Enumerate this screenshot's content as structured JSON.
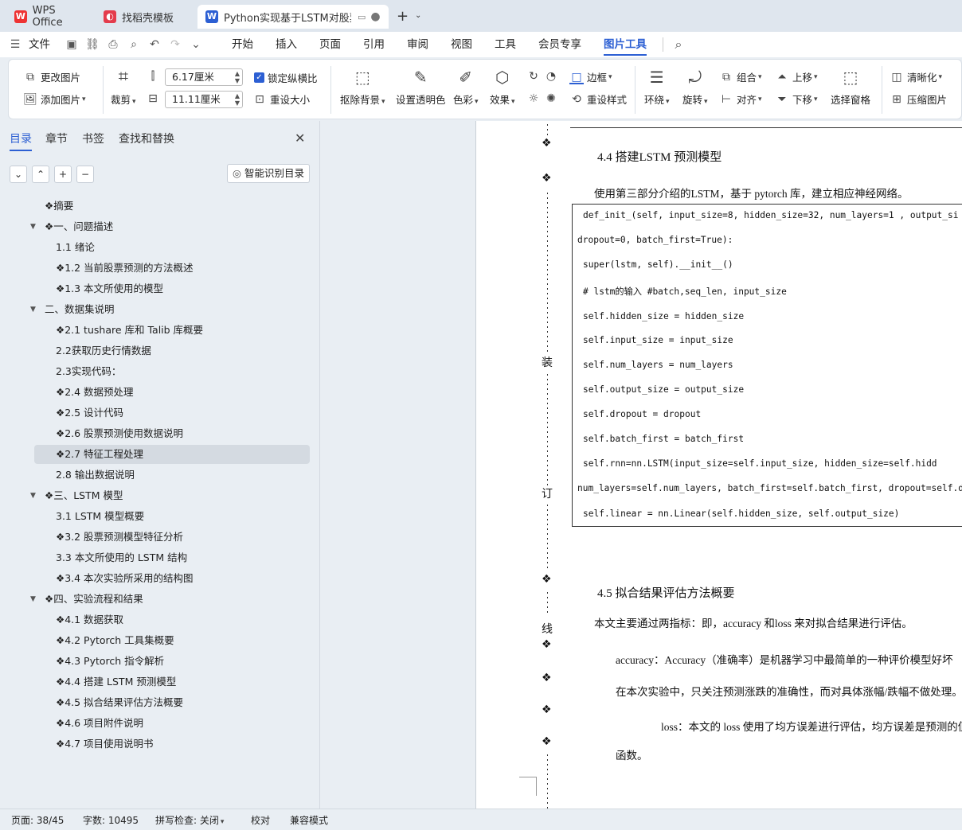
{
  "tabs": [
    {
      "label": "WPS Office",
      "icon": "wps-logo-icon"
    },
    {
      "label": "找稻壳模板",
      "icon": "docer-logo-icon"
    },
    {
      "label": "Python实现基于LSTM对股票走",
      "icon": "word-doc-icon"
    }
  ],
  "menubar": {
    "file": "文件",
    "items": [
      "开始",
      "插入",
      "页面",
      "引用",
      "审阅",
      "视图",
      "工具",
      "会员专享",
      "图片工具"
    ],
    "active": "图片工具"
  },
  "ribbon": {
    "change_picture": "更改图片",
    "add_picture": "添加图片",
    "crop": "裁剪",
    "width_value": "6.17厘米",
    "height_value": "11.11厘米",
    "lock_ratio": "锁定纵横比",
    "reset_size": "重设大小",
    "remove_bg": "抠除背景",
    "set_transparent": "设置透明色",
    "color": "色彩",
    "effects": "效果",
    "border": "边框",
    "reset_style": "重设样式",
    "wrap": "环绕",
    "rotate": "旋转",
    "group": "组合",
    "align": "对齐",
    "bring_forward": "上移",
    "send_backward": "下移",
    "selection_pane": "选择窗格",
    "sharpen": "清晰化",
    "compress": "压缩图片",
    "accent_color": "#2c5fd3"
  },
  "nav": {
    "tabs": [
      "目录",
      "章节",
      "书签",
      "查找和替换"
    ],
    "active_tab": "目录",
    "smart_toc": "智能识别目录",
    "items": [
      {
        "text": "❖摘要",
        "level": 1,
        "arrow": false
      },
      {
        "text": "❖一、问题描述",
        "level": 1,
        "arrow": true
      },
      {
        "text": "1.1 绪论",
        "level": 2,
        "arrow": false
      },
      {
        "text": "❖1.2 当前股票预测的方法概述",
        "level": 2,
        "arrow": false
      },
      {
        "text": "❖1.3 本文所使用的模型",
        "level": 2,
        "arrow": false
      },
      {
        "text": "二、数据集说明",
        "level": 1,
        "arrow": true
      },
      {
        "text": "❖2.1 tushare 库和 Talib 库概要",
        "level": 2,
        "arrow": false
      },
      {
        "text": "2.2获取历史行情数据",
        "level": 2,
        "arrow": false
      },
      {
        "text": "2.3实现代码：",
        "level": 2,
        "arrow": false
      },
      {
        "text": "❖2.4 数据预处理",
        "level": 2,
        "arrow": false
      },
      {
        "text": "❖2.5 设计代码",
        "level": 2,
        "arrow": false
      },
      {
        "text": "❖2.6 股票预测使用数据说明",
        "level": 2,
        "arrow": false
      },
      {
        "text": "❖2.7 特征工程处理",
        "level": 2,
        "arrow": false,
        "selected": true
      },
      {
        "text": "2.8 输出数据说明",
        "level": 2,
        "arrow": false
      },
      {
        "text": "❖三、LSTM 模型",
        "level": 1,
        "arrow": true
      },
      {
        "text": "3.1 LSTM 模型概要",
        "level": 2,
        "arrow": false
      },
      {
        "text": "❖3.2 股票预测模型特征分析",
        "level": 2,
        "arrow": false
      },
      {
        "text": "3.3 本文所使用的 LSTM 结构",
        "level": 2,
        "arrow": false
      },
      {
        "text": "❖3.4 本次实验所采用的结构图",
        "level": 2,
        "arrow": false
      },
      {
        "text": "❖四、实验流程和结果",
        "level": 1,
        "arrow": true
      },
      {
        "text": "❖4.1 数据获取",
        "level": 2,
        "arrow": false
      },
      {
        "text": "❖4.2 Pytorch 工具集概要",
        "level": 2,
        "arrow": false
      },
      {
        "text": "❖4.3 Pytorch 指令解析",
        "level": 2,
        "arrow": false
      },
      {
        "text": "❖4.4 搭建 LSTM 预测模型",
        "level": 2,
        "arrow": false
      },
      {
        "text": "❖4.5 拟合结果评估方法概要",
        "level": 2,
        "arrow": false
      },
      {
        "text": "❖4.6 项目附件说明",
        "level": 2,
        "arrow": false
      },
      {
        "text": "❖4.7 项目使用说明书",
        "level": 2,
        "arrow": false
      }
    ]
  },
  "doc": {
    "binding": [
      "装",
      "订",
      "线"
    ],
    "section_44": "4.4  搭建LSTM 预测模型",
    "intro_44": "使用第三部分介绍的LSTM，基于 pytorch 库，建立相应神经网络。",
    "code": [
      "  def_init_(self, input_size=8, hidden_size=32, num_layers=1 , output_si",
      "dropout=0, batch_first=True):",
      "      super(lstm, self).__init__()",
      "      # lstm的输入 #batch,seq_len, input_size",
      "      self.hidden_size = hidden_size",
      "      self.input_size = input_size",
      "      self.num_layers = num_layers",
      "      self.output_size = output_size",
      "      self.dropout = dropout",
      "      self.batch_first = batch_first",
      "      self.rnn=nn.LSTM(input_size=self.input_size, hidden_size=self.hidd",
      "num_layers=self.num_layers, batch_first=self.batch_first, dropout=self.dr",
      "      self.linear = nn.Linear(self.hidden_size, self.output_size)"
    ],
    "section_45": "4.5  拟合结果评估方法概要",
    "intro_45": "本文主要通过两指标：即，accuracy 和loss 来对拟合结果进行评估。",
    "accuracy_line": "accuracy：Accuracy（准确率）是机器学习中最简单的一种评价模型好坏",
    "accuracy_line2": "在本次实验中，只关注预测涨跌的准确性，而对具体涨幅/跌幅不做处理。",
    "loss_line": "loss：本文的 loss 使用了均方误差进行评估，均方误差是预测的值",
    "loss_line2": "函数。"
  },
  "status": {
    "page": "页面: 38/45",
    "words": "字数: 10495",
    "spell": "拼写检查: 关闭",
    "proof": "校对",
    "compat": "兼容模式"
  }
}
